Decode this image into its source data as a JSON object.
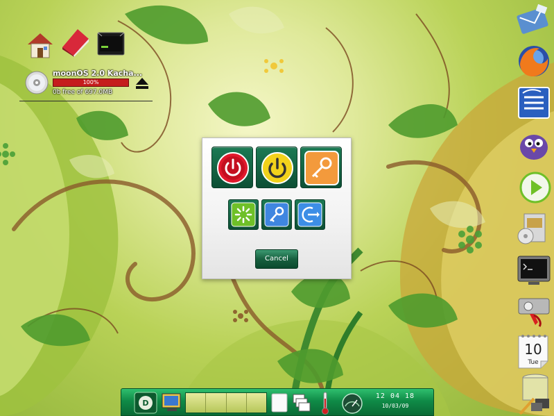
{
  "desktop": {
    "icons": [
      "home-icon",
      "book-icon",
      "terminal-icon"
    ]
  },
  "drive": {
    "name": "moonOS 2.0 Kacha...",
    "progress_label": "100%",
    "progress": 1.0,
    "free_label": "0b free of 697.0MB",
    "eject_icon": "eject-icon"
  },
  "dialog": {
    "actions": [
      {
        "id": "shutdown",
        "icon": "power-icon",
        "color": "#e0192c"
      },
      {
        "id": "suspend",
        "icon": "power-yellow-icon",
        "color": "#f2d21b"
      },
      {
        "id": "lock",
        "icon": "key-icon",
        "color": "#f39a3c"
      },
      {
        "id": "restart",
        "icon": "restart-icon",
        "color": "#6fc028"
      },
      {
        "id": "switch-user",
        "icon": "key-blue-icon",
        "color": "#3f86e0"
      },
      {
        "id": "logout",
        "icon": "logout-icon",
        "color": "#3d8ee6"
      }
    ],
    "cancel_label": "Cancel"
  },
  "dock": {
    "items": [
      "mail-icon",
      "firefox-icon",
      "writer-icon",
      "pidgin-icon",
      "media-player-icon",
      "software-icon",
      "terminal-icon",
      "settings-icon",
      "calendar-icon",
      "trash-icon",
      "tools-icon"
    ],
    "calendar_day": "10",
    "calendar_weekday": "Tue"
  },
  "panel": {
    "time": "12 04 18",
    "date": "10/03/09",
    "items": [
      "menu-icon",
      "computer-icon",
      "pager",
      "notes-icon",
      "windows-icon",
      "thermometer-icon",
      "speedometer-icon"
    ]
  }
}
